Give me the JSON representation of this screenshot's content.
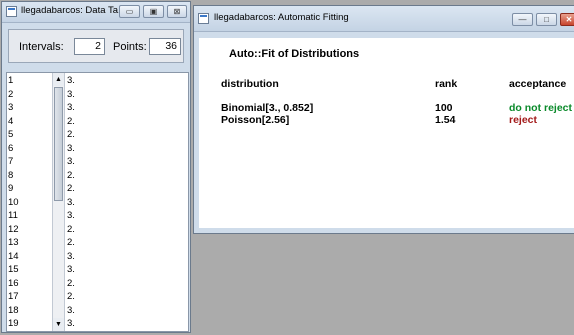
{
  "left_window": {
    "title": "llegadabarcos: Data Ta...",
    "buttons": {
      "minimize": "▭",
      "maximize": "▣",
      "close": "⊠"
    },
    "intervals_label": "Intervals:",
    "intervals_value": "2",
    "points_label": "Points:",
    "points_value": "36",
    "rows": [
      {
        "n": "1",
        "v": "3."
      },
      {
        "n": "2",
        "v": "3."
      },
      {
        "n": "3",
        "v": "3."
      },
      {
        "n": "4",
        "v": "2."
      },
      {
        "n": "5",
        "v": "2."
      },
      {
        "n": "6",
        "v": "3."
      },
      {
        "n": "7",
        "v": "3."
      },
      {
        "n": "8",
        "v": "2."
      },
      {
        "n": "9",
        "v": "2."
      },
      {
        "n": "10",
        "v": "3."
      },
      {
        "n": "11",
        "v": "3."
      },
      {
        "n": "12",
        "v": "2."
      },
      {
        "n": "13",
        "v": "2."
      },
      {
        "n": "14",
        "v": "3."
      },
      {
        "n": "15",
        "v": "3."
      },
      {
        "n": "16",
        "v": "2."
      },
      {
        "n": "17",
        "v": "2."
      },
      {
        "n": "18",
        "v": "3."
      },
      {
        "n": "19",
        "v": "3."
      }
    ],
    "scroll_up": "▲",
    "scroll_down": "▼"
  },
  "right_window": {
    "title": "llegadabarcos: Automatic Fitting",
    "buttons": {
      "minimize": "—",
      "maximize": "□",
      "close": "✕"
    },
    "heading": "Auto::Fit of Distributions",
    "columns": {
      "distribution": "distribution",
      "rank": "rank",
      "acceptance": "acceptance"
    },
    "results": [
      {
        "distribution": "Binomial[3., 0.852]",
        "rank": "100",
        "acceptance": "do not reject"
      },
      {
        "distribution": "Poisson[2.56]",
        "rank": "1.54",
        "acceptance": "reject"
      }
    ],
    "colors": {
      "do_not_reject": "#0a8a2a",
      "reject": "#a31a1a"
    }
  }
}
